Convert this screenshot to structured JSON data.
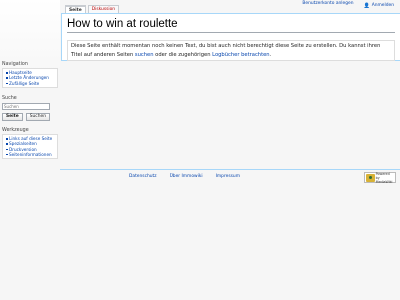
{
  "personal": {
    "create_account": "Benutzerkonto anlegen",
    "login": "Anmelden"
  },
  "tabs": [
    {
      "label": "Seite"
    },
    {
      "label": "Diskussion"
    }
  ],
  "page": {
    "title": "How to win at roulette",
    "notice": {
      "part1": "Diese Seite enthält momentan noch keinen Text, du bist auch nicht berechtigt diese Seite zu erstellen. Du kannst ihren Titel auf anderen Seiten ",
      "search_link": "suchen",
      "part2": " oder die zugehörigen ",
      "log_link": "Logbücher betrachten",
      "part3": "."
    }
  },
  "sidebar": {
    "navigation": {
      "heading": "Navigation",
      "items": [
        "Hauptseite",
        "Letzte Änderungen",
        "Zufällige Seite"
      ]
    },
    "search": {
      "heading": "Suche",
      "placeholder": "Suchen",
      "go_button": "Seite",
      "search_button": "Suchen"
    },
    "tools": {
      "heading": "Werkzeuge",
      "items": [
        "Links auf diese Seite",
        "Spezialseiten",
        "Druckversion",
        "Seiteninformationen"
      ]
    }
  },
  "footer": {
    "links": [
      "Datenschutz",
      "Über Immowiki",
      "Impressum"
    ],
    "powered_by": "Powered by",
    "powered_by_name": "MediaWiki"
  }
}
